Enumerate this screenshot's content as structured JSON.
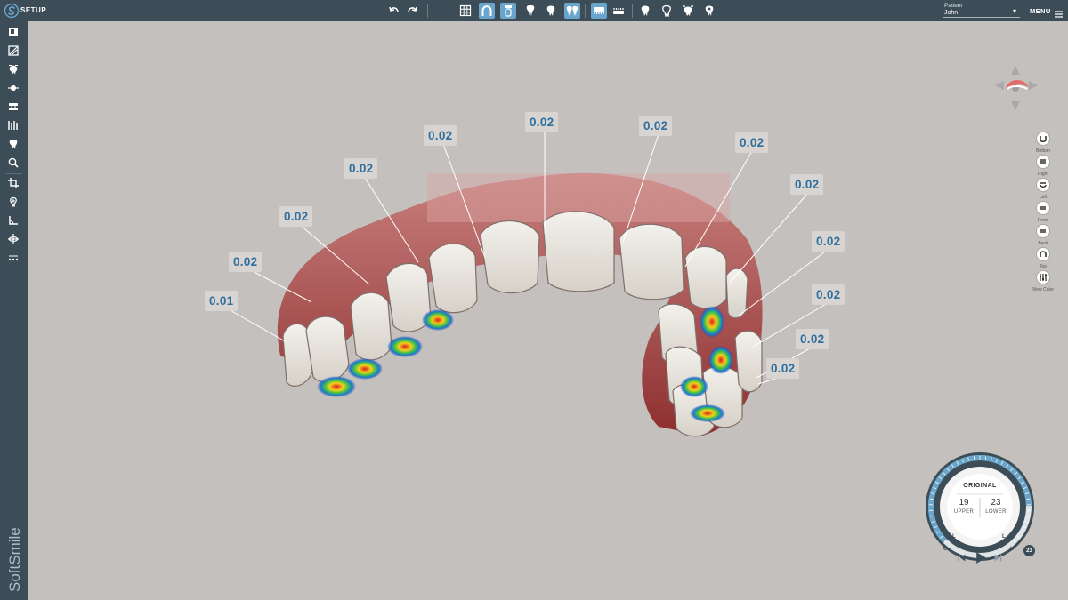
{
  "topbar": {
    "title": "SETUP",
    "patient_label": "Patient",
    "patient_name": "John",
    "menu_label": "MENU"
  },
  "viewport": {
    "distances": [
      "0.01",
      "0.02",
      "0.02",
      "0.02",
      "0.02",
      "0.02",
      "0.02",
      "0.02",
      "0.02",
      "0.02",
      "0.02",
      "0.02",
      "0.02"
    ]
  },
  "views": [
    {
      "label": "Bottom",
      "icon": "bottom-view-icon"
    },
    {
      "label": "Right",
      "icon": "right-view-icon"
    },
    {
      "label": "Left",
      "icon": "left-view-icon"
    },
    {
      "label": "Front",
      "icon": "front-view-icon"
    },
    {
      "label": "Back",
      "icon": "back-view-icon"
    },
    {
      "label": "Top",
      "icon": "top-view-icon"
    },
    {
      "label": "View Color",
      "icon": "view-color-icon"
    }
  ],
  "stage": {
    "title": "ORIGINAL",
    "upper_count": "19",
    "upper_label": "UPPER",
    "lower_count": "23",
    "lower_label": "LOWER",
    "marker_u": "U",
    "marker_l": "L",
    "badge": "23",
    "progress_fraction": 0.83
  },
  "sidebar": {
    "logo_text": "SoftSmile"
  },
  "colors": {
    "bar": "#3c4d58",
    "accent": "#6aa6cc",
    "label_text": "#2f6f9e",
    "background": "#c4c0bd"
  }
}
